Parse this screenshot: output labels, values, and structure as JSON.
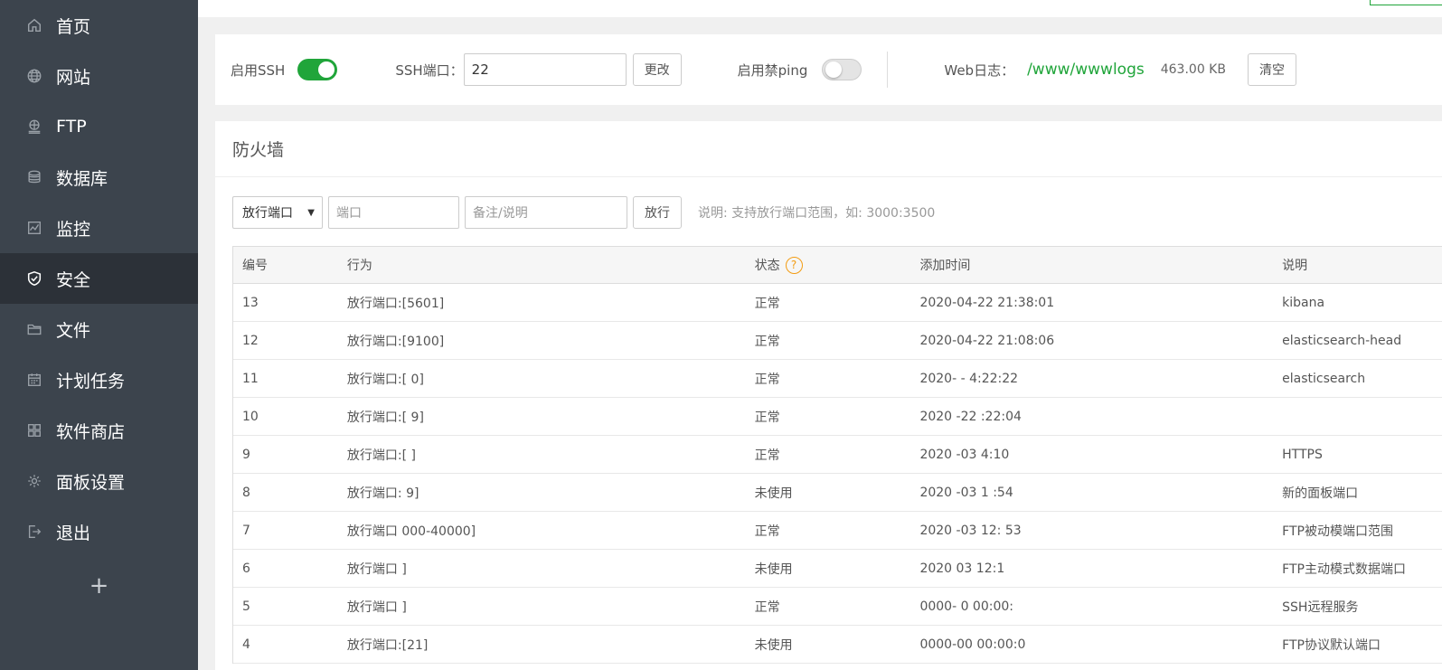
{
  "sidebar": {
    "items": [
      {
        "label": "首页",
        "icon": "home-icon"
      },
      {
        "label": "网站",
        "icon": "globe-icon"
      },
      {
        "label": "FTP",
        "icon": "ftp-icon"
      },
      {
        "label": "数据库",
        "icon": "database-icon"
      },
      {
        "label": "监控",
        "icon": "monitor-icon"
      },
      {
        "label": "安全",
        "icon": "shield-icon",
        "active": true
      },
      {
        "label": "文件",
        "icon": "folder-icon"
      },
      {
        "label": "计划任务",
        "icon": "calendar-icon"
      },
      {
        "label": "软件商店",
        "icon": "apps-icon"
      },
      {
        "label": "面板设置",
        "icon": "gear-icon"
      },
      {
        "label": "退出",
        "icon": "logout-icon"
      }
    ],
    "add_label": "+"
  },
  "ssh": {
    "enable_label": "启用SSH",
    "enabled": true,
    "port_label": "SSH端口：",
    "port_value": "22",
    "change_label": "更改",
    "ping_label": "启用禁ping",
    "ping_enabled": false,
    "weblog_label": "Web日志：",
    "weblog_path": "/www/wwwlogs",
    "weblog_size": "463.00 KB",
    "clear_label": "清空"
  },
  "firewall": {
    "title": "防火墙",
    "select_value": "放行端口",
    "port_placeholder": "端口",
    "note_placeholder": "备注/说明",
    "allow_label": "放行",
    "hint": "说明: 支持放行端口范围，如: 3000:3500",
    "headers": [
      "编号",
      "行为",
      "状态",
      "添加时间",
      "说明"
    ],
    "rows": [
      {
        "id": "13",
        "action": "放行端口:[5601]",
        "status": "正常",
        "time": "2020-04-22 21:38:01",
        "note": "kibana"
      },
      {
        "id": "12",
        "action": "放行端口:[9100]",
        "status": "正常",
        "time": "2020-04-22 21:08:06",
        "note": "elasticsearch-head"
      },
      {
        "id": "11",
        "action": "放行端口:[    0]",
        "status": "正常",
        "time": "2020-   -  4:22:22",
        "note": "elasticsearch"
      },
      {
        "id": "10",
        "action": "放行端口:[    9]",
        "status": "正常",
        "time": "2020   -22   :22:04",
        "note": ""
      },
      {
        "id": "9",
        "action": "放行端口:[     ]",
        "status": "正常",
        "time": "2020   -03    4:10",
        "note": "HTTPS"
      },
      {
        "id": "8",
        "action": "放行端口:    9]",
        "status": "未使用",
        "time": "2020   -03 1   :54",
        "note": "新的面板端口"
      },
      {
        "id": "7",
        "action": "放行端口   000-40000]",
        "status": "正常",
        "time": "2020   -03 12:   53",
        "note": "FTP被动模端口范围"
      },
      {
        "id": "6",
        "action": "放行端口      ]",
        "status": "未使用",
        "time": "2020    03 12:1   ",
        "note": "FTP主动模式数据端口"
      },
      {
        "id": "5",
        "action": "放行端口     ]",
        "status": "正常",
        "time": "0000-     0 00:00:",
        "note": "SSH远程服务"
      },
      {
        "id": "4",
        "action": "放行端口:[21]",
        "status": "未使用",
        "time": "0000-00    00:00:0",
        "note": "FTP协议默认端口"
      }
    ]
  },
  "colors": {
    "sidebar_bg": "#3c444d",
    "sidebar_active": "#2c3138",
    "accent_green": "#20a53a",
    "help_orange": "#f39c12"
  }
}
